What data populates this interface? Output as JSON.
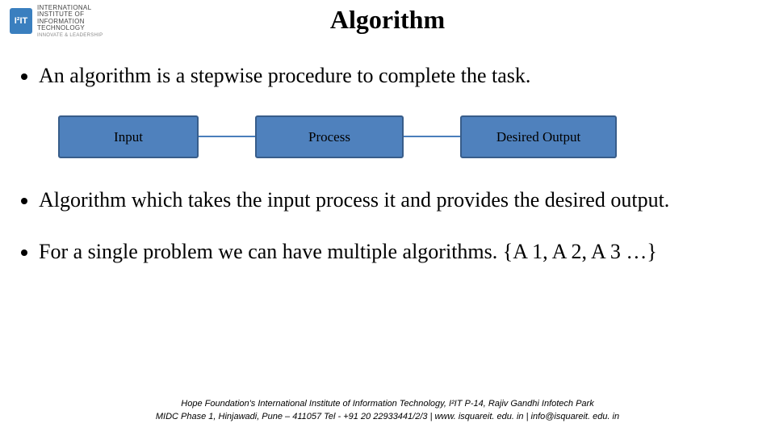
{
  "logo": {
    "badge": "I²IT",
    "line1": "INTERNATIONAL",
    "line2": "INSTITUTE OF",
    "line3": "INFORMATION",
    "line4": "TECHNOLOGY",
    "sub": "INNOVATE & LEADERSHIP"
  },
  "title": "Algorithm",
  "bullets": {
    "b1": "An algorithm is a stepwise procedure to complete the task.",
    "b2": "Algorithm which takes the input process it and provides the desired output.",
    "b3": "For a single problem we can have multiple algorithms. {A 1, A 2, A 3 …}"
  },
  "flow": {
    "n1": "Input",
    "n2": "Process",
    "n3": "Desired Output"
  },
  "footer": {
    "l1": "Hope Foundation's International Institute of Information Technology, I²IT P-14, Rajiv Gandhi Infotech Park",
    "l2": "MIDC Phase 1, Hinjawadi, Pune – 411057 Tel - +91 20 22933441/2/3 | www. isquareit. edu. in | info@isquareit. edu. in"
  }
}
